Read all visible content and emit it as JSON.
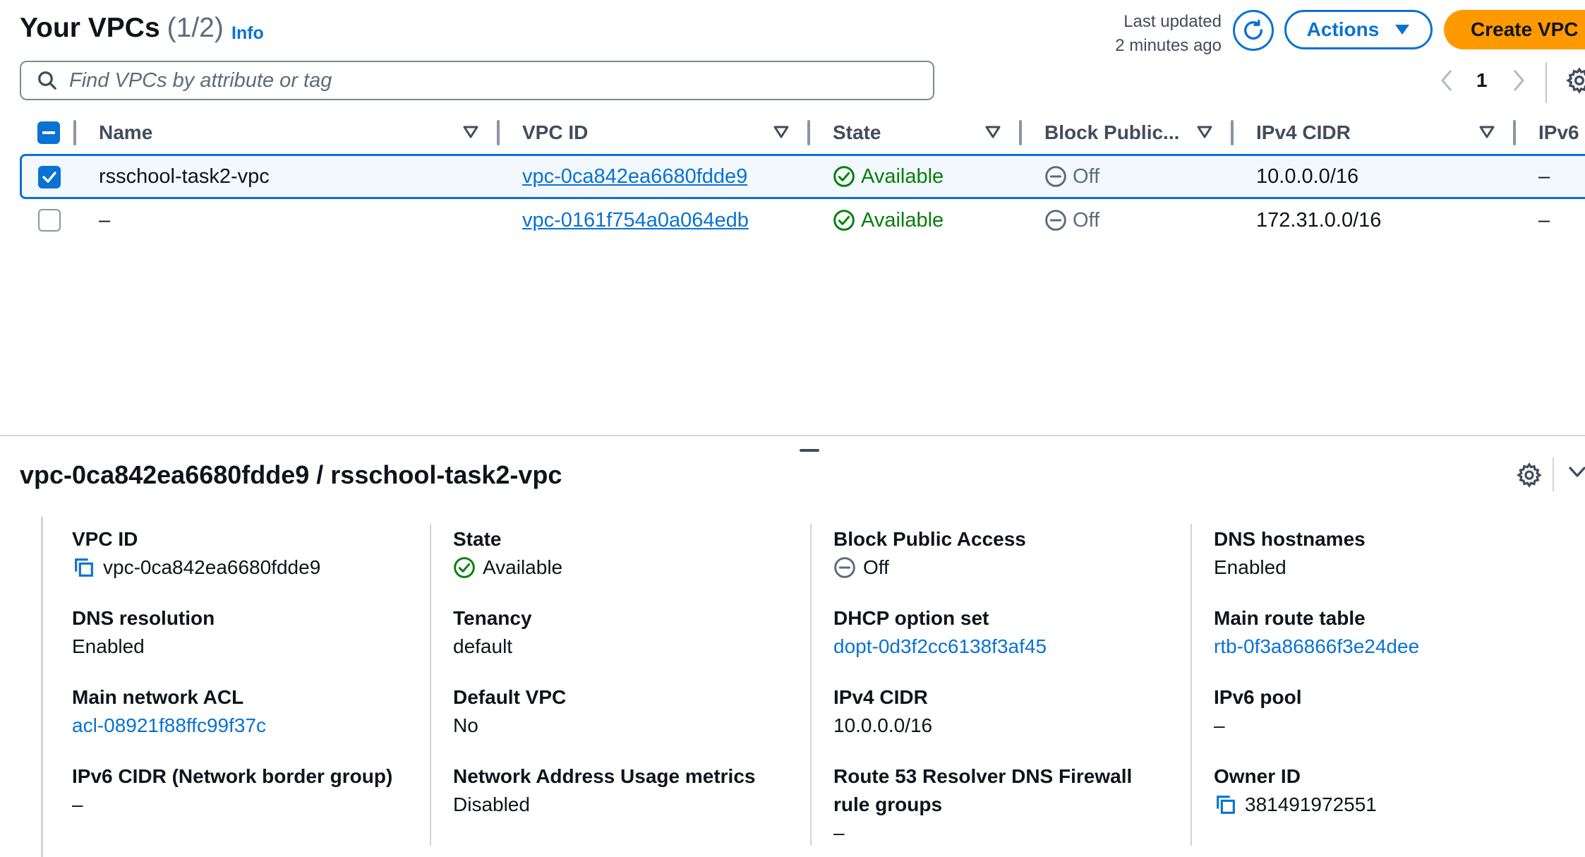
{
  "header": {
    "title": "Your VPCs",
    "count": "(1/2)",
    "info": "Info",
    "last_updated_line1": "Last updated",
    "last_updated_line2": "2 minutes ago",
    "actions": "Actions",
    "create": "Create VPC"
  },
  "search": {
    "placeholder": "Find VPCs by attribute or tag"
  },
  "pagination": {
    "page": "1"
  },
  "table": {
    "columns": [
      "Name",
      "VPC ID",
      "State",
      "Block Public...",
      "IPv4 CIDR",
      "IPv6"
    ],
    "rows": [
      {
        "selected": true,
        "name": "rsschool-task2-vpc",
        "vpc_id": "vpc-0ca842ea6680fdde9",
        "state": "Available",
        "block_public": "Off",
        "ipv4_cidr": "10.0.0.0/16",
        "ipv6": "–"
      },
      {
        "selected": false,
        "name": "–",
        "vpc_id": "vpc-0161f754a0a064edb",
        "state": "Available",
        "block_public": "Off",
        "ipv4_cidr": "172.31.0.0/16",
        "ipv6": "–"
      }
    ]
  },
  "details": {
    "title": "vpc-0ca842ea6680fdde9 / rsschool-task2-vpc",
    "fields": {
      "vpc_id": {
        "label": "VPC ID",
        "value": "vpc-0ca842ea6680fdde9"
      },
      "state": {
        "label": "State",
        "value": "Available"
      },
      "block_public_access": {
        "label": "Block Public Access",
        "value": "Off"
      },
      "dns_hostnames": {
        "label": "DNS hostnames",
        "value": "Enabled"
      },
      "dns_resolution": {
        "label": "DNS resolution",
        "value": "Enabled"
      },
      "tenancy": {
        "label": "Tenancy",
        "value": "default"
      },
      "dhcp_option_set": {
        "label": "DHCP option set",
        "value": "dopt-0d3f2cc6138f3af45"
      },
      "main_route_table": {
        "label": "Main route table",
        "value": "rtb-0f3a86866f3e24dee"
      },
      "main_network_acl": {
        "label": "Main network ACL",
        "value": "acl-08921f88ffc99f37c"
      },
      "default_vpc": {
        "label": "Default VPC",
        "value": "No"
      },
      "ipv4_cidr": {
        "label": "IPv4 CIDR",
        "value": "10.0.0.0/16"
      },
      "ipv6_pool": {
        "label": "IPv6 pool",
        "value": "–"
      },
      "ipv6_cidr": {
        "label": "IPv6 CIDR (Network border group)",
        "value": "–"
      },
      "nau_metrics": {
        "label": "Network Address Usage metrics",
        "value": "Disabled"
      },
      "route53_label_line1": "Route 53 Resolver DNS Firewall",
      "route53_label_line2": "rule groups",
      "route53_value": "–",
      "owner_id": {
        "label": "Owner ID",
        "value": "381491972551"
      }
    }
  },
  "colors": {
    "link": "#0972d3",
    "success": "#037f0c",
    "primary_button": "#ff9900",
    "muted": "#5f6b7a"
  }
}
